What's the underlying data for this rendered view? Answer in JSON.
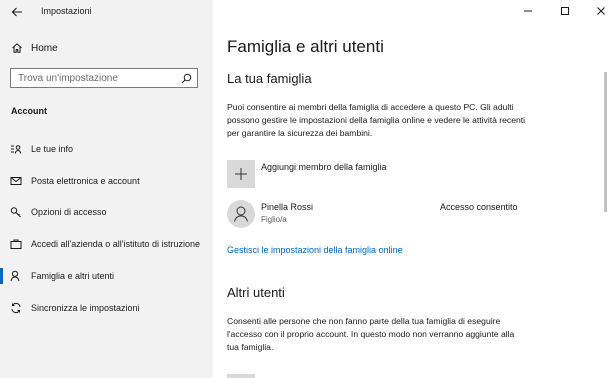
{
  "window": {
    "title": "Impostazioni"
  },
  "sidebar": {
    "home_label": "Home",
    "search_placeholder": "Trova un'impostazione",
    "section_label": "Account",
    "items": [
      {
        "label": "Le tue info",
        "icon": "user-info-icon"
      },
      {
        "label": "Posta elettronica e account",
        "icon": "mail-icon"
      },
      {
        "label": "Opzioni di accesso",
        "icon": "key-icon"
      },
      {
        "label": "Accedi all'azienda o all'istituto di istruzione",
        "icon": "briefcase-icon"
      },
      {
        "label": "Famiglia e altri utenti",
        "icon": "person-icon",
        "active": true
      },
      {
        "label": "Sincronizza le impostazioni",
        "icon": "sync-icon"
      }
    ]
  },
  "main": {
    "title": "Famiglia e altri utenti",
    "family": {
      "heading": "La tua famiglia",
      "description": "Puoi consentire ai membri della famiglia di accedere a questo PC. Gli adulti possono gestire le impostazioni della famiglia online e vedere le attività recenti per garantire la sicurezza dei bambini.",
      "add_label": "Aggiungi membro della famiglia",
      "member": {
        "name": "Pinella Rossi",
        "role": "Figlio/a",
        "status": "Accesso consentito"
      },
      "link": "Gestisci le impostazioni della famiglia online"
    },
    "others": {
      "heading": "Altri utenti",
      "description": "Consenti alle persone che non fanno parte della tua famiglia di eseguire l'accesso con il proprio account. In questo modo non verranno aggiunte alla tua famiglia."
    }
  },
  "colors": {
    "accent": "#0067c0",
    "sidebar_bg": "#f2f2f2",
    "tile_bg": "#d9d9d9"
  }
}
